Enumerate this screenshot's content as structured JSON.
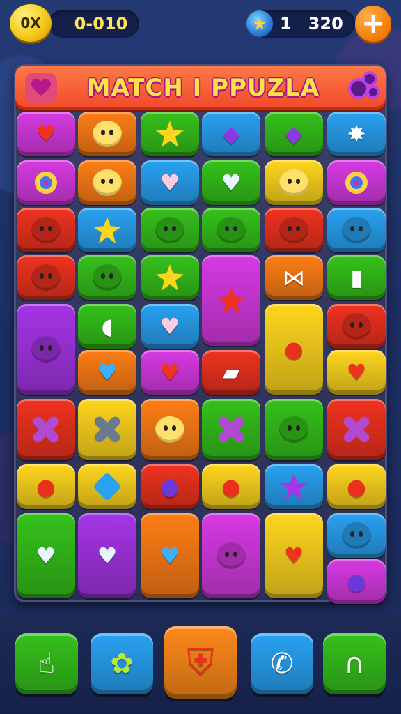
{
  "top_bar": {
    "coin_badge": "0X",
    "score": "0-010",
    "gem_count": "1",
    "gem_amount": "320",
    "plus_label": "+"
  },
  "banner": {
    "title": "MATCH I PPUZLA"
  },
  "colors": {
    "red": "#f0331f",
    "orange": "#ff7e16",
    "yellow": "#ffd61e",
    "green": "#35c21b",
    "blue": "#29a2f2",
    "purple": "#a535e6",
    "magenta": "#d73ae3"
  },
  "tiles": [
    {
      "row": 0,
      "col": 0,
      "color": "magenta",
      "icon": "apple-icon",
      "glyph": "♥"
    },
    {
      "row": 0,
      "col": 1,
      "color": "orange",
      "icon": "smiley-face-icon",
      "glyph": "face"
    },
    {
      "row": 0,
      "col": 2,
      "color": "green",
      "icon": "star-icon",
      "glyph": "star"
    },
    {
      "row": 0,
      "col": 3,
      "color": "blue",
      "icon": "tag-icon",
      "glyph": "◆"
    },
    {
      "row": 0,
      "col": 4,
      "color": "green",
      "icon": "gem-icon",
      "glyph": "◆"
    },
    {
      "row": 0,
      "col": 5,
      "color": "blue",
      "icon": "splat-icon",
      "glyph": "✸"
    },
    {
      "row": 1,
      "col": 0,
      "color": "magenta",
      "icon": "ring-icon",
      "glyph": "ring"
    },
    {
      "row": 1,
      "col": 1,
      "color": "orange",
      "icon": "strawberry-face-icon",
      "glyph": "face"
    },
    {
      "row": 1,
      "col": 2,
      "color": "blue",
      "icon": "heart-icon",
      "glyph": "♥"
    },
    {
      "row": 1,
      "col": 3,
      "color": "green",
      "icon": "heart-icon",
      "glyph": "♥"
    },
    {
      "row": 1,
      "col": 4,
      "color": "yellow",
      "icon": "smiley-face-icon",
      "glyph": "face"
    },
    {
      "row": 1,
      "col": 5,
      "color": "magenta",
      "icon": "ring-icon",
      "glyph": "ring"
    },
    {
      "row": 2,
      "col": 0,
      "color": "red",
      "icon": "sun-face-icon",
      "glyph": "face"
    },
    {
      "row": 2,
      "col": 1,
      "color": "blue",
      "icon": "star-icon",
      "glyph": "star"
    },
    {
      "row": 2,
      "col": 2,
      "color": "green",
      "icon": "sun-face-icon",
      "glyph": "face"
    },
    {
      "row": 2,
      "col": 3,
      "color": "green",
      "icon": "smiley-face-icon",
      "glyph": "face"
    },
    {
      "row": 2,
      "col": 4,
      "color": "red",
      "icon": "hexagon-face-icon",
      "glyph": "face"
    },
    {
      "row": 2,
      "col": 5,
      "color": "blue",
      "icon": "ball-face-icon",
      "glyph": "face"
    },
    {
      "row": 3,
      "col": 0,
      "color": "red",
      "icon": "blob-face-icon",
      "glyph": "face"
    },
    {
      "row": 3,
      "col": 1,
      "color": "green",
      "icon": "tomato-face-icon",
      "glyph": "face"
    },
    {
      "row": 3,
      "col": 2,
      "color": "green",
      "icon": "star-icon",
      "glyph": "star"
    },
    {
      "row": 3,
      "col": 3,
      "color": "magenta",
      "icon": "star-icon",
      "glyph": "star",
      "tall": true
    },
    {
      "row": 3,
      "col": 4,
      "color": "orange",
      "icon": "bow-icon",
      "glyph": "⋈"
    },
    {
      "row": 3,
      "col": 5,
      "color": "green",
      "icon": "potion-icon",
      "glyph": "▮"
    },
    {
      "row": 4,
      "col": 0,
      "color": "purple",
      "icon": "bubble-face-icon",
      "glyph": "face",
      "tall": true
    },
    {
      "row": 4,
      "col": 1,
      "color": "green",
      "icon": "leaf-icon",
      "glyph": "◖"
    },
    {
      "row": 4,
      "col": 2,
      "color": "blue",
      "icon": "heart-icon",
      "glyph": "♥"
    },
    {
      "row": 4,
      "col": 4,
      "color": "yellow",
      "icon": "lemon-icon",
      "glyph": "●",
      "tall": true
    },
    {
      "row": 4,
      "col": 5,
      "color": "red",
      "icon": "apple-face-icon",
      "glyph": "face"
    },
    {
      "row": 5,
      "col": 1,
      "color": "orange",
      "icon": "heart-icon",
      "glyph": "♥"
    },
    {
      "row": 5,
      "col": 2,
      "color": "magenta",
      "icon": "heart-icon",
      "glyph": "♥"
    },
    {
      "row": 5,
      "col": 3,
      "color": "red",
      "icon": "flag-icon",
      "glyph": "▰"
    },
    {
      "row": 5,
      "col": 5,
      "color": "yellow",
      "icon": "heart-icon",
      "glyph": "♥"
    },
    {
      "row": 6,
      "col": 0,
      "color": "red",
      "icon": "bone-icon",
      "glyph": "bone"
    },
    {
      "row": 6,
      "col": 1,
      "color": "yellow",
      "icon": "bone-icon",
      "glyph": "bone"
    },
    {
      "row": 6,
      "col": 2,
      "color": "orange",
      "icon": "bear-face-icon",
      "glyph": "face"
    },
    {
      "row": 6,
      "col": 3,
      "color": "green",
      "icon": "bone-icon",
      "glyph": "bone"
    },
    {
      "row": 6,
      "col": 4,
      "color": "green",
      "icon": "frog-face-icon",
      "glyph": "face"
    },
    {
      "row": 6,
      "col": 5,
      "color": "red",
      "icon": "bone-icon",
      "glyph": "bone"
    },
    {
      "row": 7,
      "col": 0,
      "color": "yellow",
      "icon": "apple-icon",
      "glyph": "●"
    },
    {
      "row": 7,
      "col": 1,
      "color": "yellow",
      "icon": "diamond-icon",
      "glyph": "diamond"
    },
    {
      "row": 7,
      "col": 2,
      "color": "red",
      "icon": "speech-bubble-icon",
      "glyph": "●"
    },
    {
      "row": 7,
      "col": 3,
      "color": "yellow",
      "icon": "apple-icon",
      "glyph": "●"
    },
    {
      "row": 7,
      "col": 4,
      "color": "blue",
      "icon": "starfish-icon",
      "glyph": "star"
    },
    {
      "row": 7,
      "col": 5,
      "color": "yellow",
      "icon": "apple-icon",
      "glyph": "●"
    },
    {
      "row": 8,
      "col": 0,
      "color": "green",
      "icon": "heart-icon",
      "glyph": "♥",
      "tall": true
    },
    {
      "row": 8,
      "col": 1,
      "color": "purple",
      "icon": "heart-face-icon",
      "glyph": "♥",
      "tall": true
    },
    {
      "row": 8,
      "col": 2,
      "color": "orange",
      "icon": "heart-icon",
      "glyph": "♥",
      "tall": true
    },
    {
      "row": 8,
      "col": 3,
      "color": "magenta",
      "icon": "ghost-face-icon",
      "glyph": "face",
      "tall": true
    },
    {
      "row": 8,
      "col": 4,
      "color": "yellow",
      "icon": "heart-icon",
      "glyph": "♥",
      "tall": true
    },
    {
      "row": 8,
      "col": 5,
      "color": "blue",
      "icon": "plum-face-icon",
      "glyph": "face"
    },
    {
      "row": 9,
      "col": 5,
      "color": "magenta",
      "icon": "plum-icon",
      "glyph": "●"
    }
  ],
  "bottom_bar": {
    "buttons": [
      {
        "name": "hand-pointer-button",
        "icon": "hand-pointer-icon",
        "glyph": "☝",
        "color": "#35c21b"
      },
      {
        "name": "character-button",
        "icon": "blob-character-icon",
        "glyph": "✿",
        "color": "#29a2f2"
      },
      {
        "name": "shield-button",
        "icon": "shield-icon",
        "glyph": "⛨",
        "color": "#ff8a1a"
      },
      {
        "name": "phone-button",
        "icon": "phone-icon",
        "glyph": "✆",
        "color": "#29a2f2"
      },
      {
        "name": "headset-button",
        "icon": "headset-icon",
        "glyph": "∩",
        "color": "#35c21b"
      }
    ]
  }
}
